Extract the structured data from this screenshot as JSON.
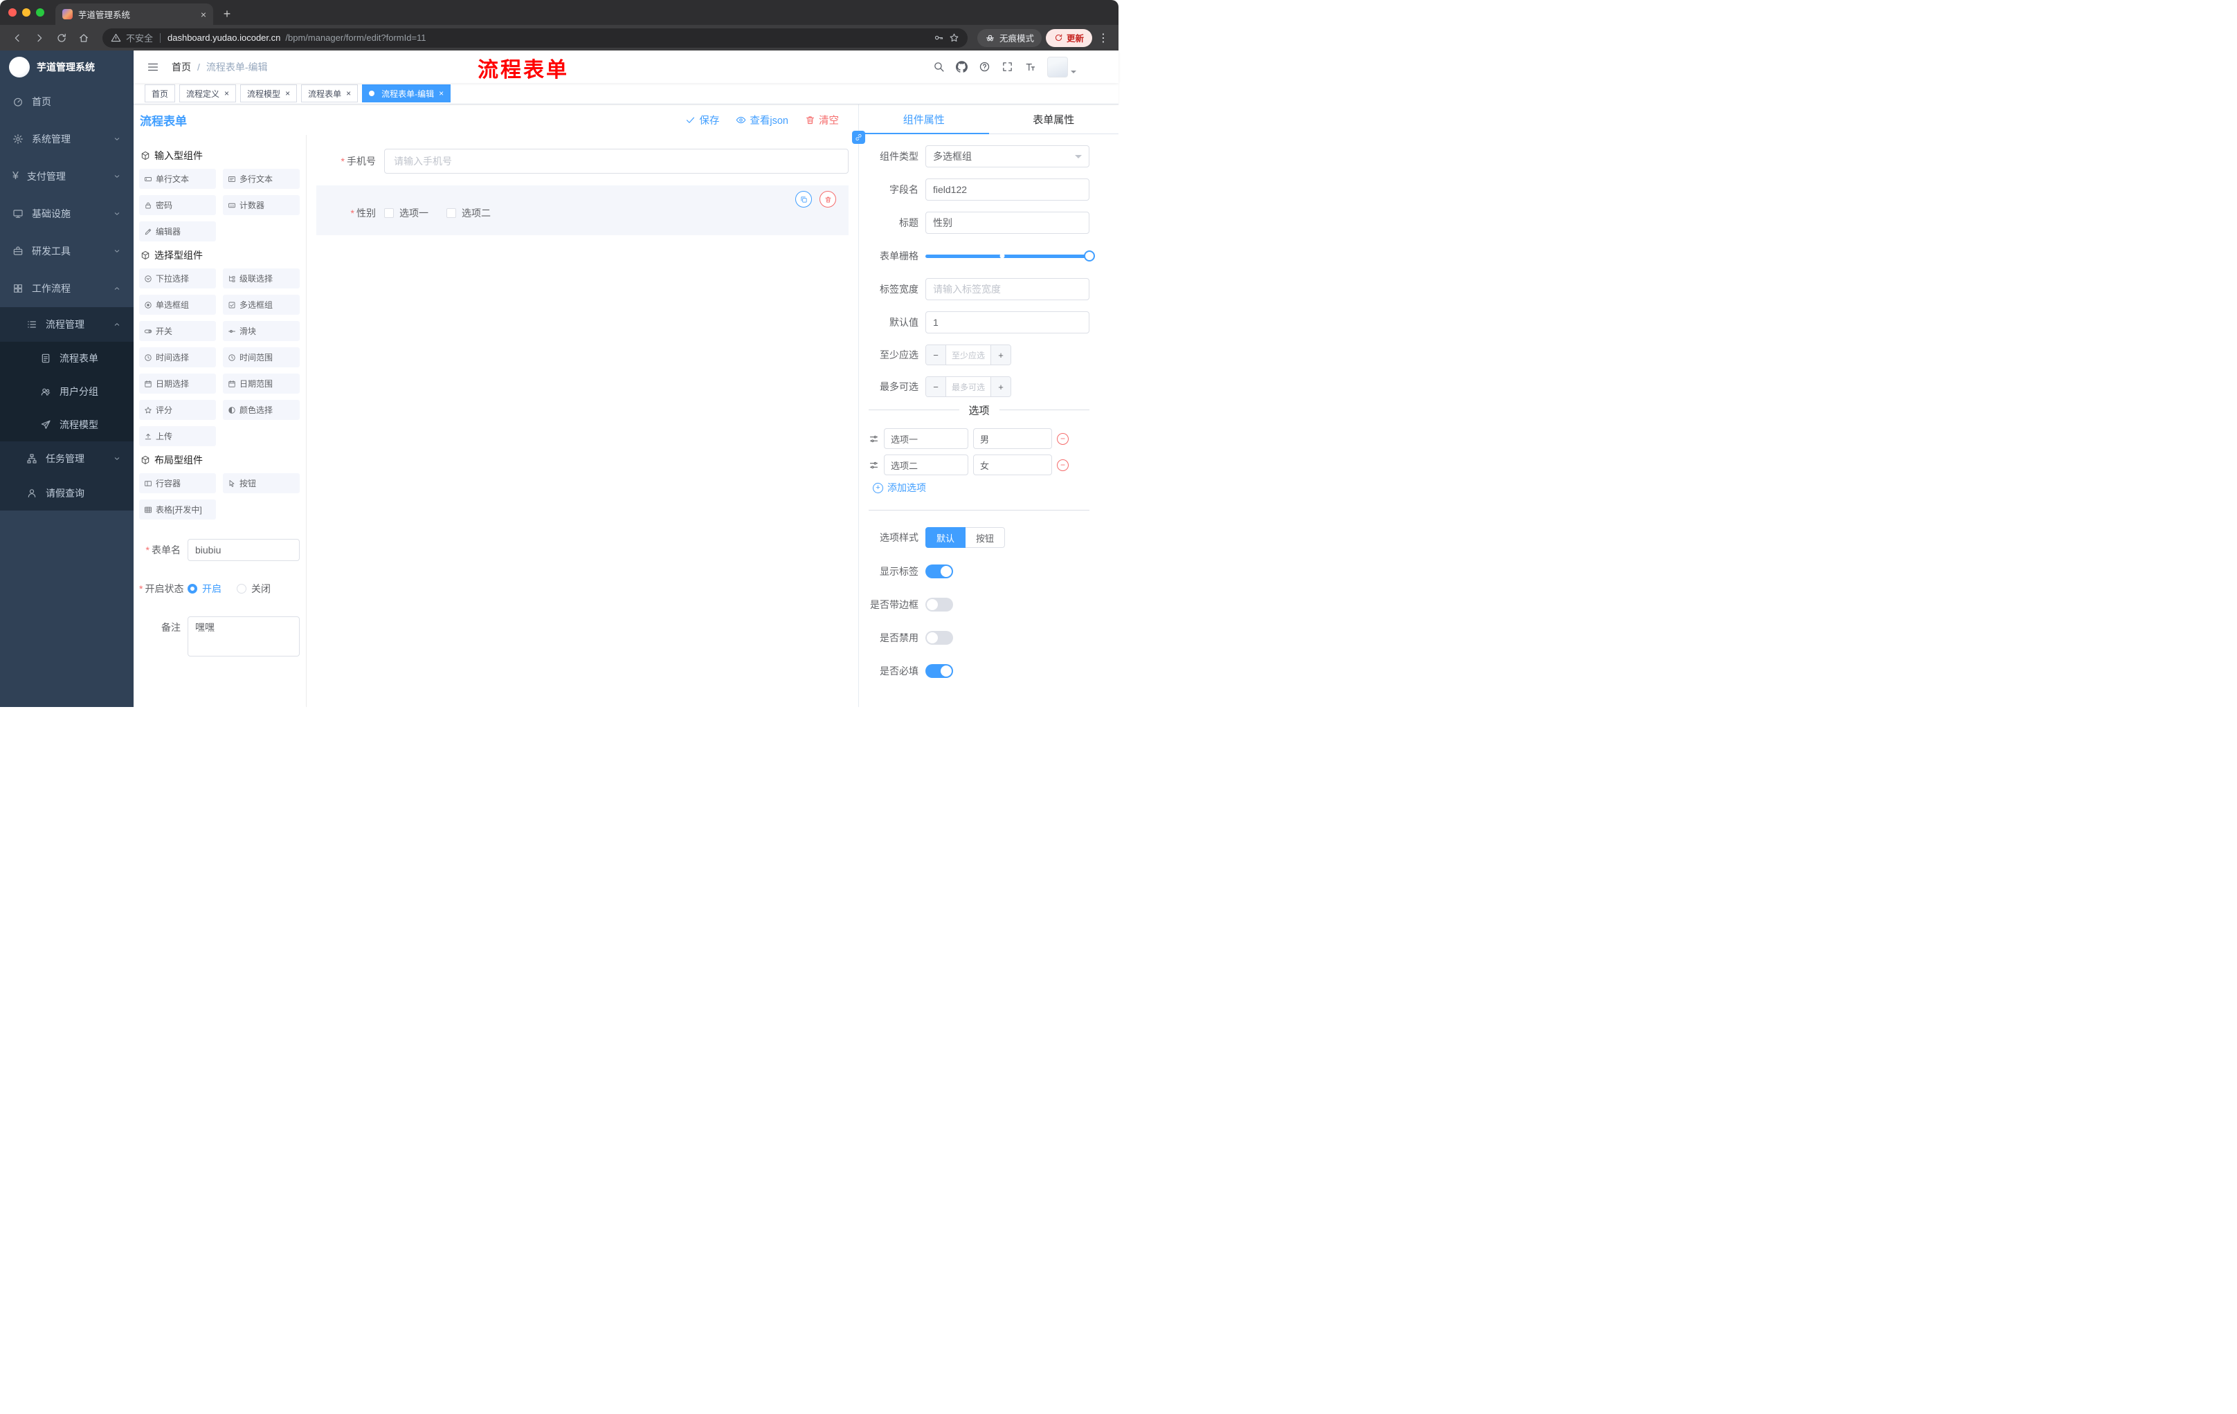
{
  "glyphs": {
    "close": "×",
    "plus": "+",
    "minus": "−",
    "slash": "/",
    "ellipsis_v": "⋮",
    "yen": "¥"
  },
  "browser": {
    "tab_title": "芋道管理系统",
    "security_label": "不安全",
    "url_host": "dashboard.yudao.iocoder.cn",
    "url_path": "/bpm/manager/form/edit?formId=11",
    "incognito_label": "无痕模式",
    "update_label": "更新"
  },
  "sidebar": {
    "logo_title": "芋道管理系统",
    "items": [
      {
        "label": "首页"
      },
      {
        "label": "系统管理"
      },
      {
        "label": "支付管理"
      },
      {
        "label": "基础设施"
      },
      {
        "label": "研发工具"
      },
      {
        "label": "工作流程"
      },
      {
        "label": "流程管理"
      },
      {
        "label": "流程表单"
      },
      {
        "label": "用户分组"
      },
      {
        "label": "流程模型"
      },
      {
        "label": "任务管理"
      },
      {
        "label": "请假查询"
      }
    ]
  },
  "navbar": {
    "breadcrumb": [
      {
        "label": "首页"
      },
      {
        "label": "流程表单-编辑"
      }
    ],
    "annotation": "流程表单"
  },
  "tags": [
    {
      "label": "首页"
    },
    {
      "label": "流程定义"
    },
    {
      "label": "流程模型"
    },
    {
      "label": "流程表单"
    },
    {
      "label": "流程表单-编辑"
    }
  ],
  "editor": {
    "title": "流程表单",
    "actions": {
      "save": "保存",
      "view_json": "查看json",
      "clear": "清空"
    },
    "palette": {
      "sections": [
        {
          "title": "输入型组件",
          "items": [
            {
              "label": "单行文本"
            },
            {
              "label": "多行文本"
            },
            {
              "label": "密码"
            },
            {
              "label": "计数器"
            },
            {
              "label": "编辑器"
            }
          ]
        },
        {
          "title": "选择型组件",
          "items": [
            {
              "label": "下拉选择"
            },
            {
              "label": "级联选择"
            },
            {
              "label": "单选框组"
            },
            {
              "label": "多选框组"
            },
            {
              "label": "开关"
            },
            {
              "label": "滑块"
            },
            {
              "label": "时间选择"
            },
            {
              "label": "时间范围"
            },
            {
              "label": "日期选择"
            },
            {
              "label": "日期范围"
            },
            {
              "label": "评分"
            },
            {
              "label": "颜色选择"
            },
            {
              "label": "上传"
            }
          ]
        },
        {
          "title": "布局型组件",
          "items": [
            {
              "label": "行容器"
            },
            {
              "label": "按钮"
            },
            {
              "label": "表格[开发中]"
            }
          ]
        }
      ]
    },
    "meta": {
      "name_label": "表单名",
      "name_value": "biubiu",
      "status_label": "开启状态",
      "status_on": "开启",
      "status_off": "关闭",
      "remark_label": "备注",
      "remark_value": "嘿嘿"
    },
    "canvas": {
      "phone_label": "手机号",
      "phone_placeholder": "请输入手机号",
      "gender_label": "性别",
      "gender_option1": "选项一",
      "gender_option2": "选项二"
    }
  },
  "props": {
    "tab_component": "组件属性",
    "tab_form": "表单属性",
    "component_type_label": "组件类型",
    "component_type_value": "多选框组",
    "field_name_label": "字段名",
    "field_name_value": "field122",
    "title_label": "标题",
    "title_value": "性别",
    "grid_label": "表单栅格",
    "label_width_label": "标签宽度",
    "label_width_placeholder": "请输入标签宽度",
    "default_label": "默认值",
    "default_value": "1",
    "min_label": "至少应选",
    "min_placeholder": "至少应选",
    "max_label": "最多可选",
    "max_placeholder": "最多可选",
    "options_title": "选项",
    "options": [
      {
        "label": "选项一",
        "value": "男"
      },
      {
        "label": "选项二",
        "value": "女"
      }
    ],
    "add_option": "添加选项",
    "option_style_label": "选项样式",
    "option_style_default": "默认",
    "option_style_button": "按钮",
    "toggle_show_label": "显示标签",
    "toggle_border": "是否带边框",
    "toggle_disabled": "是否禁用",
    "toggle_required": "是否必填"
  },
  "colors": {
    "accent": "#409eff",
    "danger": "#f56c6c",
    "annotation": "#ff0000",
    "sidebar_bg": "#304156",
    "submenu_bg": "#1f2d3d"
  }
}
